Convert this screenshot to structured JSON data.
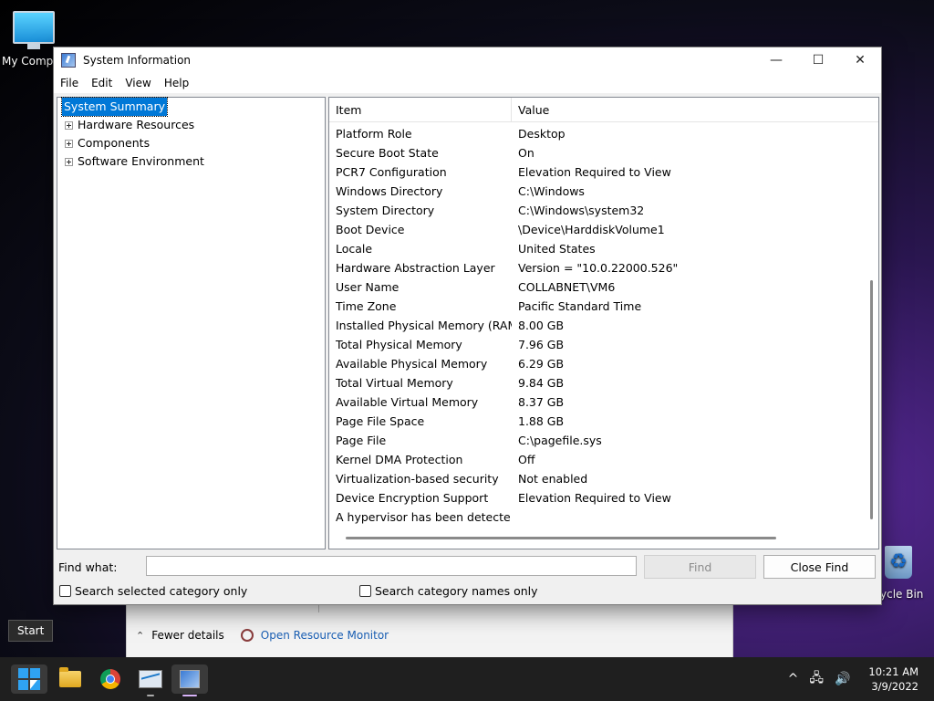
{
  "desktop": {
    "icons": [
      {
        "label": "My Comp"
      },
      {
        "label": "ycle Bin"
      }
    ]
  },
  "window": {
    "title": "System Information",
    "controls": {
      "minimize": "—",
      "maximize": "☐",
      "close": "✕"
    },
    "menu": [
      "File",
      "Edit",
      "View",
      "Help"
    ],
    "tree": {
      "root": "System Summary",
      "children": [
        "Hardware Resources",
        "Components",
        "Software Environment"
      ]
    },
    "list": {
      "headers": {
        "item": "Item",
        "value": "Value"
      },
      "rows": [
        {
          "item": "Platform Role",
          "value": "Desktop"
        },
        {
          "item": "Secure Boot State",
          "value": "On"
        },
        {
          "item": "PCR7 Configuration",
          "value": "Elevation Required to View"
        },
        {
          "item": "Windows Directory",
          "value": "C:\\Windows"
        },
        {
          "item": "System Directory",
          "value": "C:\\Windows\\system32"
        },
        {
          "item": "Boot Device",
          "value": "\\Device\\HarddiskVolume1"
        },
        {
          "item": "Locale",
          "value": "United States"
        },
        {
          "item": "Hardware Abstraction Layer",
          "value": "Version = \"10.0.22000.526\""
        },
        {
          "item": "User Name",
          "value": "COLLABNET\\VM6"
        },
        {
          "item": "Time Zone",
          "value": "Pacific Standard Time"
        },
        {
          "item": "Installed Physical Memory (RAM)",
          "value": "8.00 GB"
        },
        {
          "item": "Total Physical Memory",
          "value": "7.96 GB"
        },
        {
          "item": "Available Physical Memory",
          "value": "6.29 GB"
        },
        {
          "item": "Total Virtual Memory",
          "value": "9.84 GB"
        },
        {
          "item": "Available Virtual Memory",
          "value": "8.37 GB"
        },
        {
          "item": "Page File Space",
          "value": "1.88 GB"
        },
        {
          "item": "Page File",
          "value": "C:\\pagefile.sys"
        },
        {
          "item": "Kernel DMA Protection",
          "value": "Off"
        },
        {
          "item": "Virtualization-based security",
          "value": "Not enabled"
        },
        {
          "item": "Device Encryption Support",
          "value": "Elevation Required to View"
        },
        {
          "item": "A hypervisor has been detecte...",
          "value": ""
        }
      ]
    },
    "find": {
      "label": "Find what:",
      "value": "",
      "find_button": "Find",
      "close_button": "Close Find",
      "check_selected": "Search selected category only",
      "check_names": "Search category names only"
    }
  },
  "taskmgr": {
    "fewer_details": "Fewer details",
    "open_resource_monitor": "Open Resource Monitor"
  },
  "tooltip": "Start",
  "taskbar": {
    "time": "10:21 AM",
    "date": "3/9/2022",
    "tray_chevron": "^"
  }
}
